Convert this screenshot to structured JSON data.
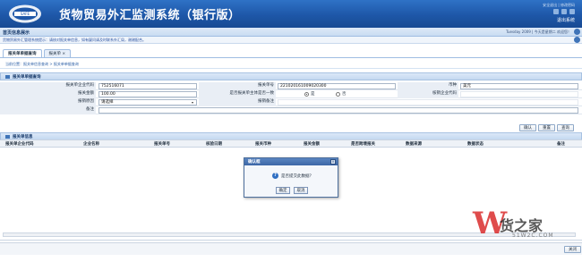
{
  "app": {
    "title": "货物贸易外汇监测系统（银行版）",
    "top_links": "安全退出 | 修改密码",
    "user_link": "退出系统"
  },
  "notice": {
    "label": "首页信息展示",
    "info": "Tuesday 2009 | 今天是星期二 欢迎您！",
    "marquee": "货物贸易外汇管理系统提示：请核对报关单信息，如有疑问请及时联系外汇局，谢谢配合。"
  },
  "tabs": [
    {
      "label": "报关单单据查询"
    },
    {
      "label": "报关单 ×"
    }
  ],
  "breadcrumb": "当前位置：报关单信息查询 > 报关单单据查询",
  "search_section": {
    "title": "报关单单据查询",
    "fields": {
      "customs_code_label": "报关单企业代码",
      "customs_code_value": "752516071",
      "decl_no_label": "报关单号",
      "decl_no_value": "221020161009020300",
      "currency_label": "币种",
      "currency_value": "美元",
      "amount_label": "报关金额",
      "amount_value": "100.00",
      "consistent_label": "是否报关单主体是否一致",
      "radio_yes": "是",
      "radio_no": "否",
      "agent_label": "核销企业代码",
      "reason_label": "报销原因",
      "reason_value": "请选择",
      "reason_desc_label": "报销备注",
      "remark_label": "备注"
    },
    "buttons": {
      "submit": "确认",
      "reset": "重置",
      "query": "查询"
    }
  },
  "results_section": {
    "title": "报关单信息",
    "columns": [
      "报关单企业代码",
      "企业名称",
      "报关单号",
      "核验日期",
      "报关币种",
      "报关金额",
      "是否跨境报关",
      "数据来源",
      "数据状态",
      "备注"
    ]
  },
  "footer": {
    "close_label": "关闭"
  },
  "dialog": {
    "title": "确认框",
    "message": "是否提交此数据？",
    "ok": "确定",
    "cancel": "取消"
  },
  "watermark": {
    "text": "货之家",
    "url": "51W2C.COM"
  },
  "colors": {
    "banner": "#1e57a8",
    "section_header": "#c4d8f0",
    "dialog_title": "#3c66a6",
    "watermark_red": "#d82020"
  }
}
